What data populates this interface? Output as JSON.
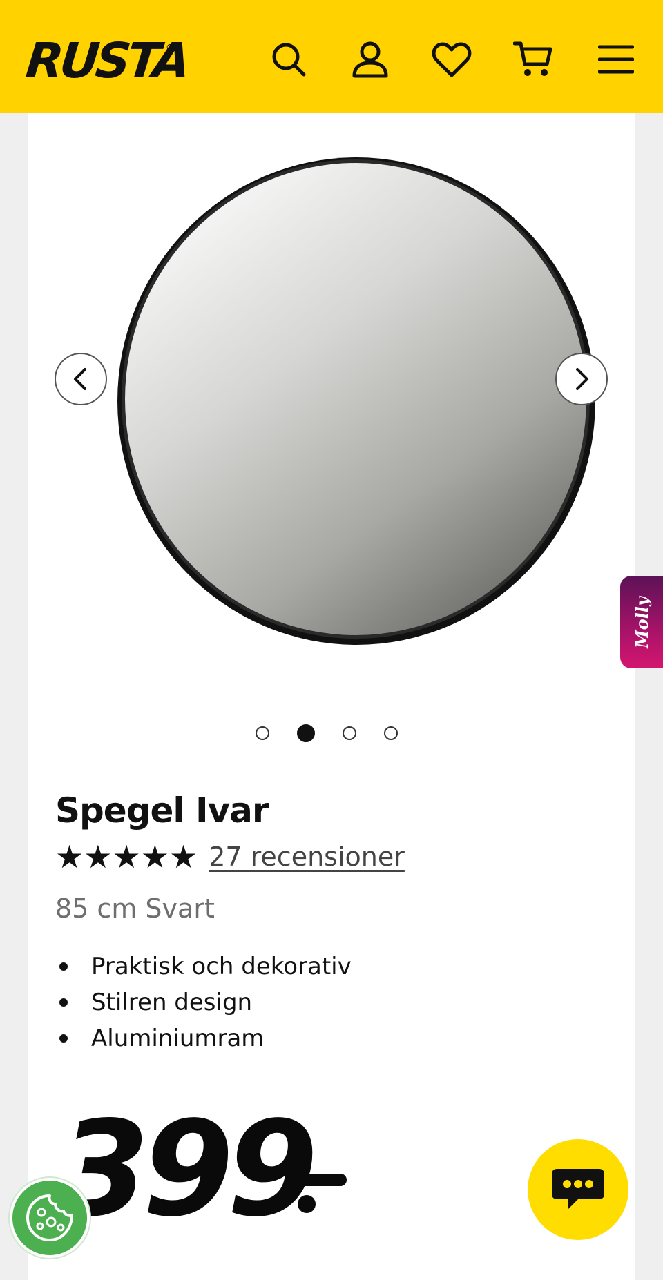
{
  "header": {
    "logo": "RUSTA",
    "logo_mark": "®",
    "icons": [
      "search-icon",
      "user-icon",
      "heart-icon",
      "cart-icon",
      "menu-icon"
    ],
    "background": "#ffd200"
  },
  "product": {
    "title": "Spegel Ivar",
    "rating_stars": 5,
    "rating_glyphs": "★★★★★",
    "reviews_label": "27 recensioner",
    "variant": "85 cm Svart",
    "features": [
      "Praktisk och dekorativ",
      "Stilren design",
      "Aluminiumram"
    ],
    "price": "399",
    "price_suffix": ".-"
  },
  "gallery": {
    "total_images": 4,
    "active_index": 1,
    "prev_icon": "chevron-left-icon",
    "next_icon": "chevron-right-icon"
  },
  "widgets": {
    "molly_label": "Molly",
    "chat_icon": "chat-bubble-icon",
    "cookie_icon": "cookie-icon",
    "accent_magenta": "#b4136b",
    "accent_green": "#4caf50",
    "accent_yellow": "#ffdd00"
  }
}
